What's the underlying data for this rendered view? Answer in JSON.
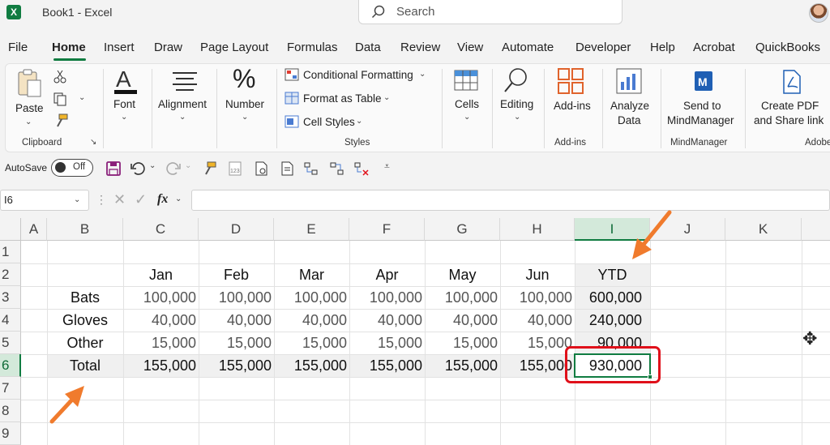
{
  "app": {
    "title": "Book1  -  Excel",
    "logo_letter": "X",
    "search_placeholder": "Search"
  },
  "tabs": [
    "File",
    "Home",
    "Insert",
    "Draw",
    "Page Layout",
    "Formulas",
    "Data",
    "Review",
    "View",
    "Automate",
    "Developer",
    "Help",
    "Acrobat",
    "QuickBooks"
  ],
  "active_tab": "Home",
  "ribbon": {
    "paste": "Paste",
    "clipboard_group": "Clipboard",
    "font": "Font",
    "alignment": "Alignment",
    "number": "Number",
    "conditional_formatting": "Conditional Formatting",
    "format_as_table": "Format as Table",
    "cell_styles": "Cell Styles",
    "styles_group": "Styles",
    "cells": "Cells",
    "editing": "Editing",
    "addins": "Add-ins",
    "addins_group": "Add-ins",
    "analyze_line1": "Analyze",
    "analyze_line2": "Data",
    "send_line1": "Send to",
    "send_line2": "MindManager",
    "mindmanager_group": "MindManager",
    "createpdf_line1": "Create PDF",
    "createpdf_line2": "and Share link",
    "adobe_group": "Adobe"
  },
  "qat": {
    "autosave_label": "AutoSave",
    "autosave_state": "Off"
  },
  "formula_bar": {
    "name_box": "I6",
    "fx": "fx",
    "content": ""
  },
  "grid": {
    "columns": [
      "A",
      "B",
      "C",
      "D",
      "E",
      "F",
      "G",
      "H",
      "I",
      "J",
      "K"
    ],
    "rows": [
      "1",
      "2",
      "3",
      "4",
      "5",
      "6",
      "7",
      "8",
      "9"
    ],
    "selected_cell": "I6",
    "month_headers": [
      "Jan",
      "Feb",
      "Mar",
      "Apr",
      "May",
      "Jun",
      "YTD"
    ],
    "data_rows": [
      {
        "label": "Bats",
        "values": [
          "100,000",
          "100,000",
          "100,000",
          "100,000",
          "100,000",
          "100,000"
        ],
        "ytd": "600,000"
      },
      {
        "label": "Gloves",
        "values": [
          "40,000",
          "40,000",
          "40,000",
          "40,000",
          "40,000",
          "40,000"
        ],
        "ytd": "240,000"
      },
      {
        "label": "Other",
        "values": [
          "15,000",
          "15,000",
          "15,000",
          "15,000",
          "15,000",
          "15,000"
        ],
        "ytd": "90,000"
      },
      {
        "label": "Total",
        "values": [
          "155,000",
          "155,000",
          "155,000",
          "155,000",
          "155,000",
          "155,000"
        ],
        "ytd": "930,000"
      }
    ]
  },
  "colors": {
    "excel_green": "#107c41",
    "highlight_red": "#e0101a",
    "arrow_orange": "#f07b2d"
  }
}
